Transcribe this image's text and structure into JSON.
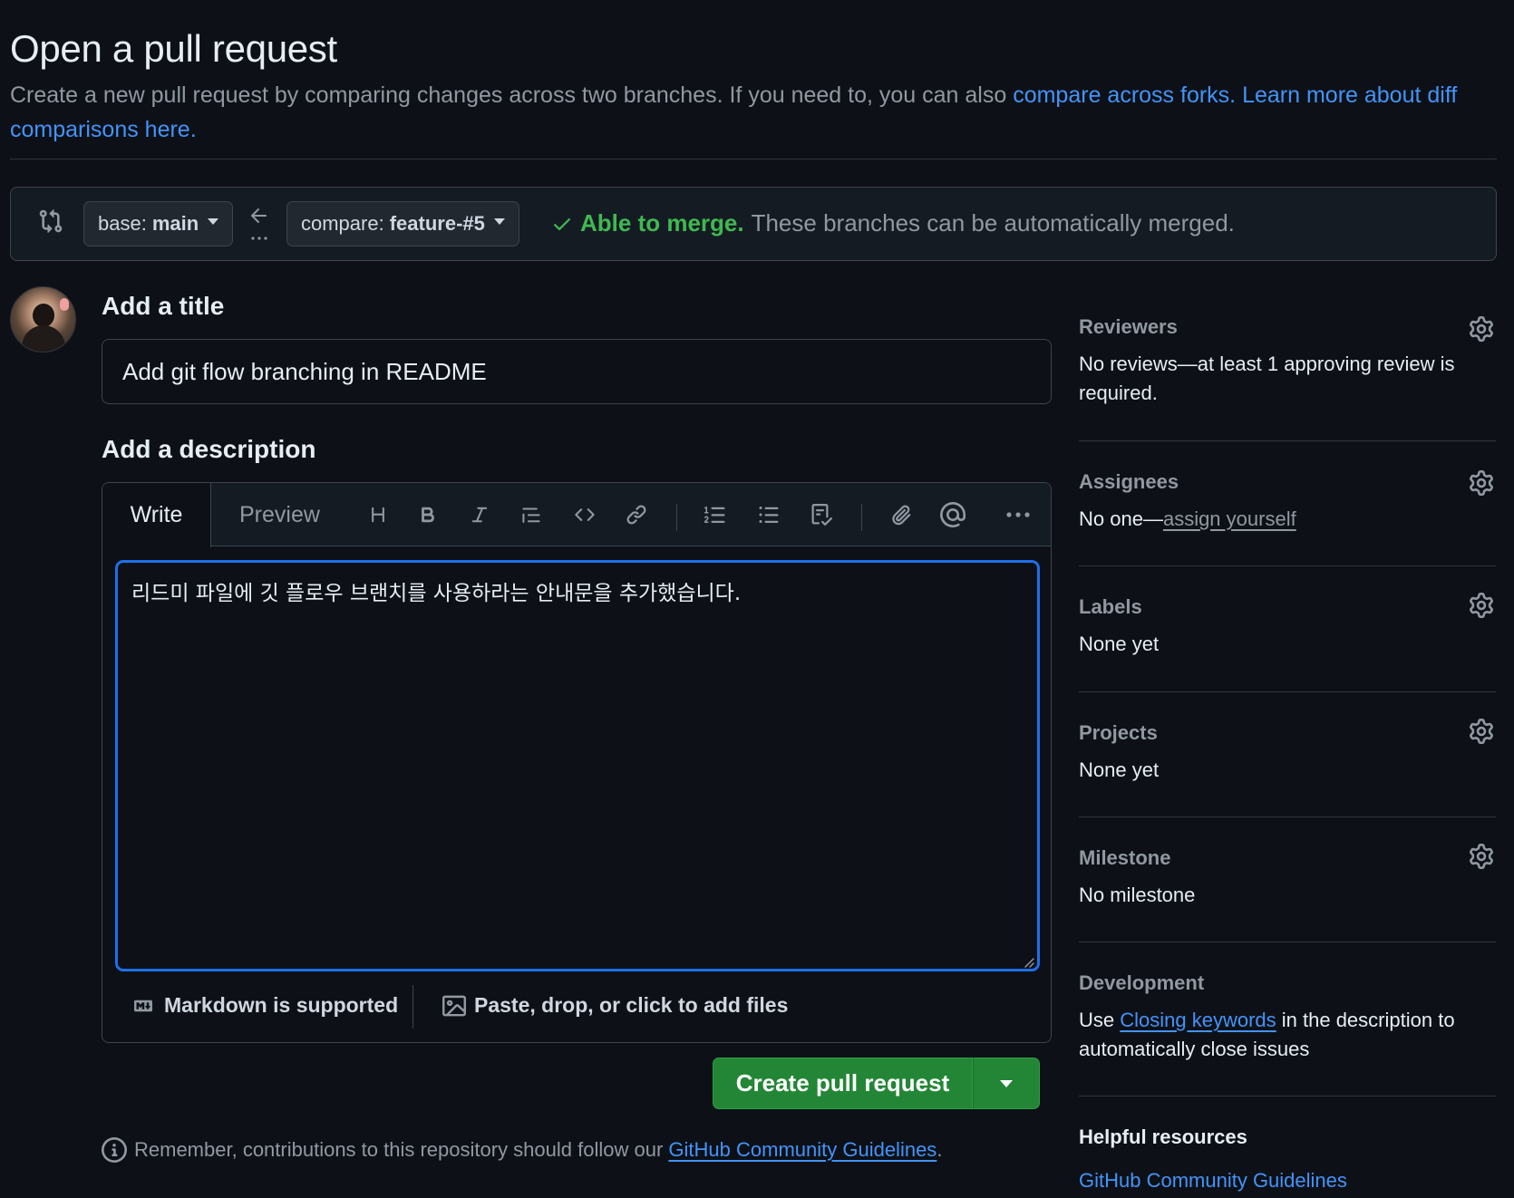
{
  "header": {
    "title": "Open a pull request",
    "description_prefix": "Create a new pull request by comparing changes across two branches. If you need to, you can also ",
    "link_forks": "compare across forks.",
    "link_learn": "Learn more about diff comparisons here."
  },
  "compare": {
    "base_prefix": "base:",
    "base_branch": "main",
    "compare_prefix": "compare:",
    "compare_branch": "feature-#5",
    "merge_ok": "Able to merge.",
    "merge_msg": "These branches can be automatically merged."
  },
  "form": {
    "title_heading": "Add a title",
    "title_value": "Add git flow branching in README",
    "desc_heading": "Add a description",
    "tab_write": "Write",
    "tab_preview": "Preview",
    "body_value": "리드미 파일에 깃 플로우 브랜치를 사용하라는 안내문을 추가했습니다.",
    "markdown_note": "Markdown is supported",
    "files_note": "Paste, drop, or click to add files",
    "create_button": "Create pull request",
    "remember_prefix": "Remember, contributions to this repository should follow our ",
    "remember_link": "GitHub Community Guidelines",
    "remember_suffix": "."
  },
  "sidebar": {
    "reviewers": {
      "label": "Reviewers",
      "value": "No reviews—at least 1 approving review is required."
    },
    "assignees": {
      "label": "Assignees",
      "value_prefix": "No one—",
      "link": "assign yourself"
    },
    "labels": {
      "label": "Labels",
      "value": "None yet"
    },
    "projects": {
      "label": "Projects",
      "value": "None yet"
    },
    "milestone": {
      "label": "Milestone",
      "value": "No milestone"
    },
    "development": {
      "label": "Development",
      "prefix": "Use ",
      "link": "Closing keywords",
      "suffix": " in the description to automatically close issues"
    },
    "helpful": {
      "label": "Helpful resources",
      "link": "GitHub Community Guidelines"
    }
  },
  "colors": {
    "accent": "#4493f8",
    "success": "#3fb950",
    "button_green": "#238636",
    "focus_border": "#1f6feb"
  }
}
